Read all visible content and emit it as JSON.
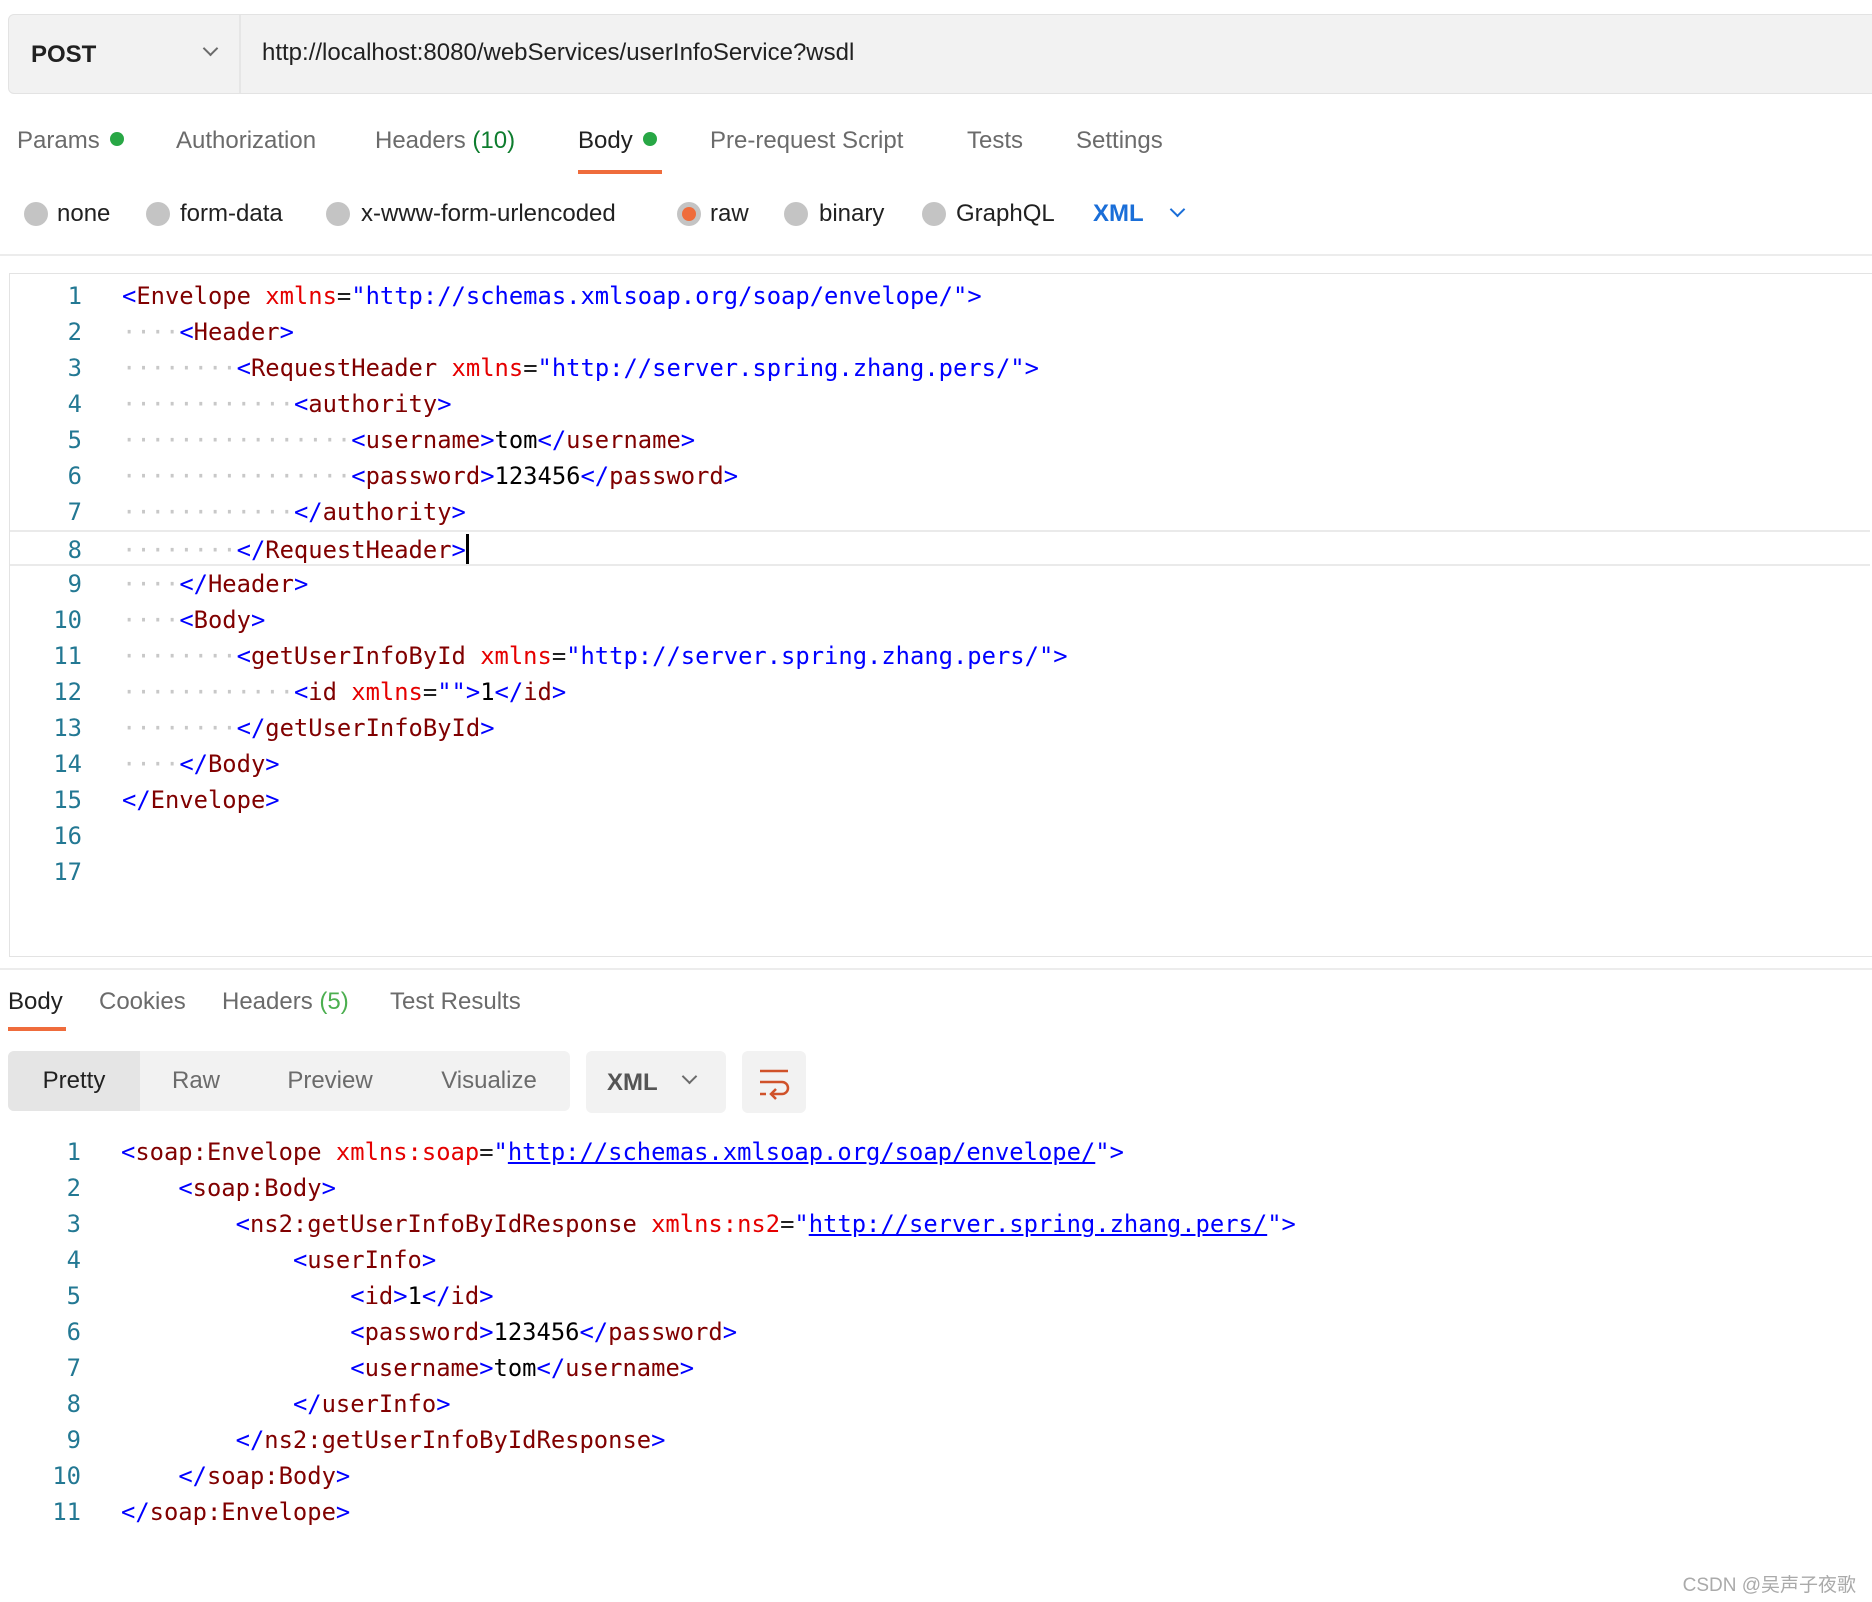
{
  "request": {
    "method": "POST",
    "url": "http://localhost:8080/webServices/userInfoService?wsdl",
    "tabs": [
      {
        "label": "Params",
        "dot": true
      },
      {
        "label": "Authorization"
      },
      {
        "label": "Headers",
        "count": "(10)"
      },
      {
        "label": "Body",
        "dot": true,
        "active": true
      },
      {
        "label": "Pre-request Script"
      },
      {
        "label": "Tests"
      },
      {
        "label": "Settings"
      }
    ],
    "body_types": [
      {
        "label": "none"
      },
      {
        "label": "form-data"
      },
      {
        "label": "x-www-form-urlencoded"
      },
      {
        "label": "raw",
        "selected": true
      },
      {
        "label": "binary"
      },
      {
        "label": "GraphQL"
      }
    ],
    "language": "XML",
    "editor": {
      "current_line": 8,
      "lines": [
        {
          "indent": 0,
          "text": "<Envelope xmlns=\"http://schemas.xmlsoap.org/soap/envelope/\">"
        },
        {
          "indent": 1,
          "text": "<Header>"
        },
        {
          "indent": 2,
          "text": "<RequestHeader xmlns=\"http://server.spring.zhang.pers/\">"
        },
        {
          "indent": 3,
          "text": "<authority>"
        },
        {
          "indent": 4,
          "text": "<username>tom</username>"
        },
        {
          "indent": 4,
          "text": "<password>123456</password>"
        },
        {
          "indent": 3,
          "text": "</authority>"
        },
        {
          "indent": 2,
          "text": "</RequestHeader>"
        },
        {
          "indent": 1,
          "text": "</Header>"
        },
        {
          "indent": 1,
          "text": "<Body>"
        },
        {
          "indent": 2,
          "text": "<getUserInfoById xmlns=\"http://server.spring.zhang.pers/\">"
        },
        {
          "indent": 3,
          "text": "<id xmlns=\"\">1</id>"
        },
        {
          "indent": 2,
          "text": "</getUserInfoById>"
        },
        {
          "indent": 1,
          "text": "</Body>"
        },
        {
          "indent": 0,
          "text": "</Envelope>"
        },
        {
          "indent": 0,
          "text": ""
        },
        {
          "indent": 0,
          "text": ""
        }
      ]
    }
  },
  "response": {
    "tabs": [
      {
        "label": "Body",
        "active": true
      },
      {
        "label": "Cookies"
      },
      {
        "label": "Headers",
        "count": "(5)"
      },
      {
        "label": "Test Results"
      }
    ],
    "view_modes": [
      "Pretty",
      "Raw",
      "Preview",
      "Visualize"
    ],
    "active_view": "Pretty",
    "format": "XML",
    "wrap_icon": "wrap-lines-icon",
    "lines": [
      {
        "indent": 0,
        "text": "<soap:Envelope xmlns:soap=\"http://schemas.xmlsoap.org/soap/envelope/\">"
      },
      {
        "indent": 1,
        "text": "<soap:Body>"
      },
      {
        "indent": 2,
        "text": "<ns2:getUserInfoByIdResponse xmlns:ns2=\"http://server.spring.zhang.pers/\">"
      },
      {
        "indent": 3,
        "text": "<userInfo>"
      },
      {
        "indent": 4,
        "text": "<id>1</id>"
      },
      {
        "indent": 4,
        "text": "<password>123456</password>"
      },
      {
        "indent": 4,
        "text": "<username>tom</username>"
      },
      {
        "indent": 3,
        "text": "</userInfo>"
      },
      {
        "indent": 2,
        "text": "</ns2:getUserInfoByIdResponse>"
      },
      {
        "indent": 1,
        "text": "</soap:Body>"
      },
      {
        "indent": 0,
        "text": "</soap:Envelope>"
      }
    ]
  },
  "watermark": "CSDN @吴声子夜歌",
  "colors": {
    "accent": "#ef6c3c",
    "dot": "#28a745",
    "link": "#1a6ed8"
  }
}
